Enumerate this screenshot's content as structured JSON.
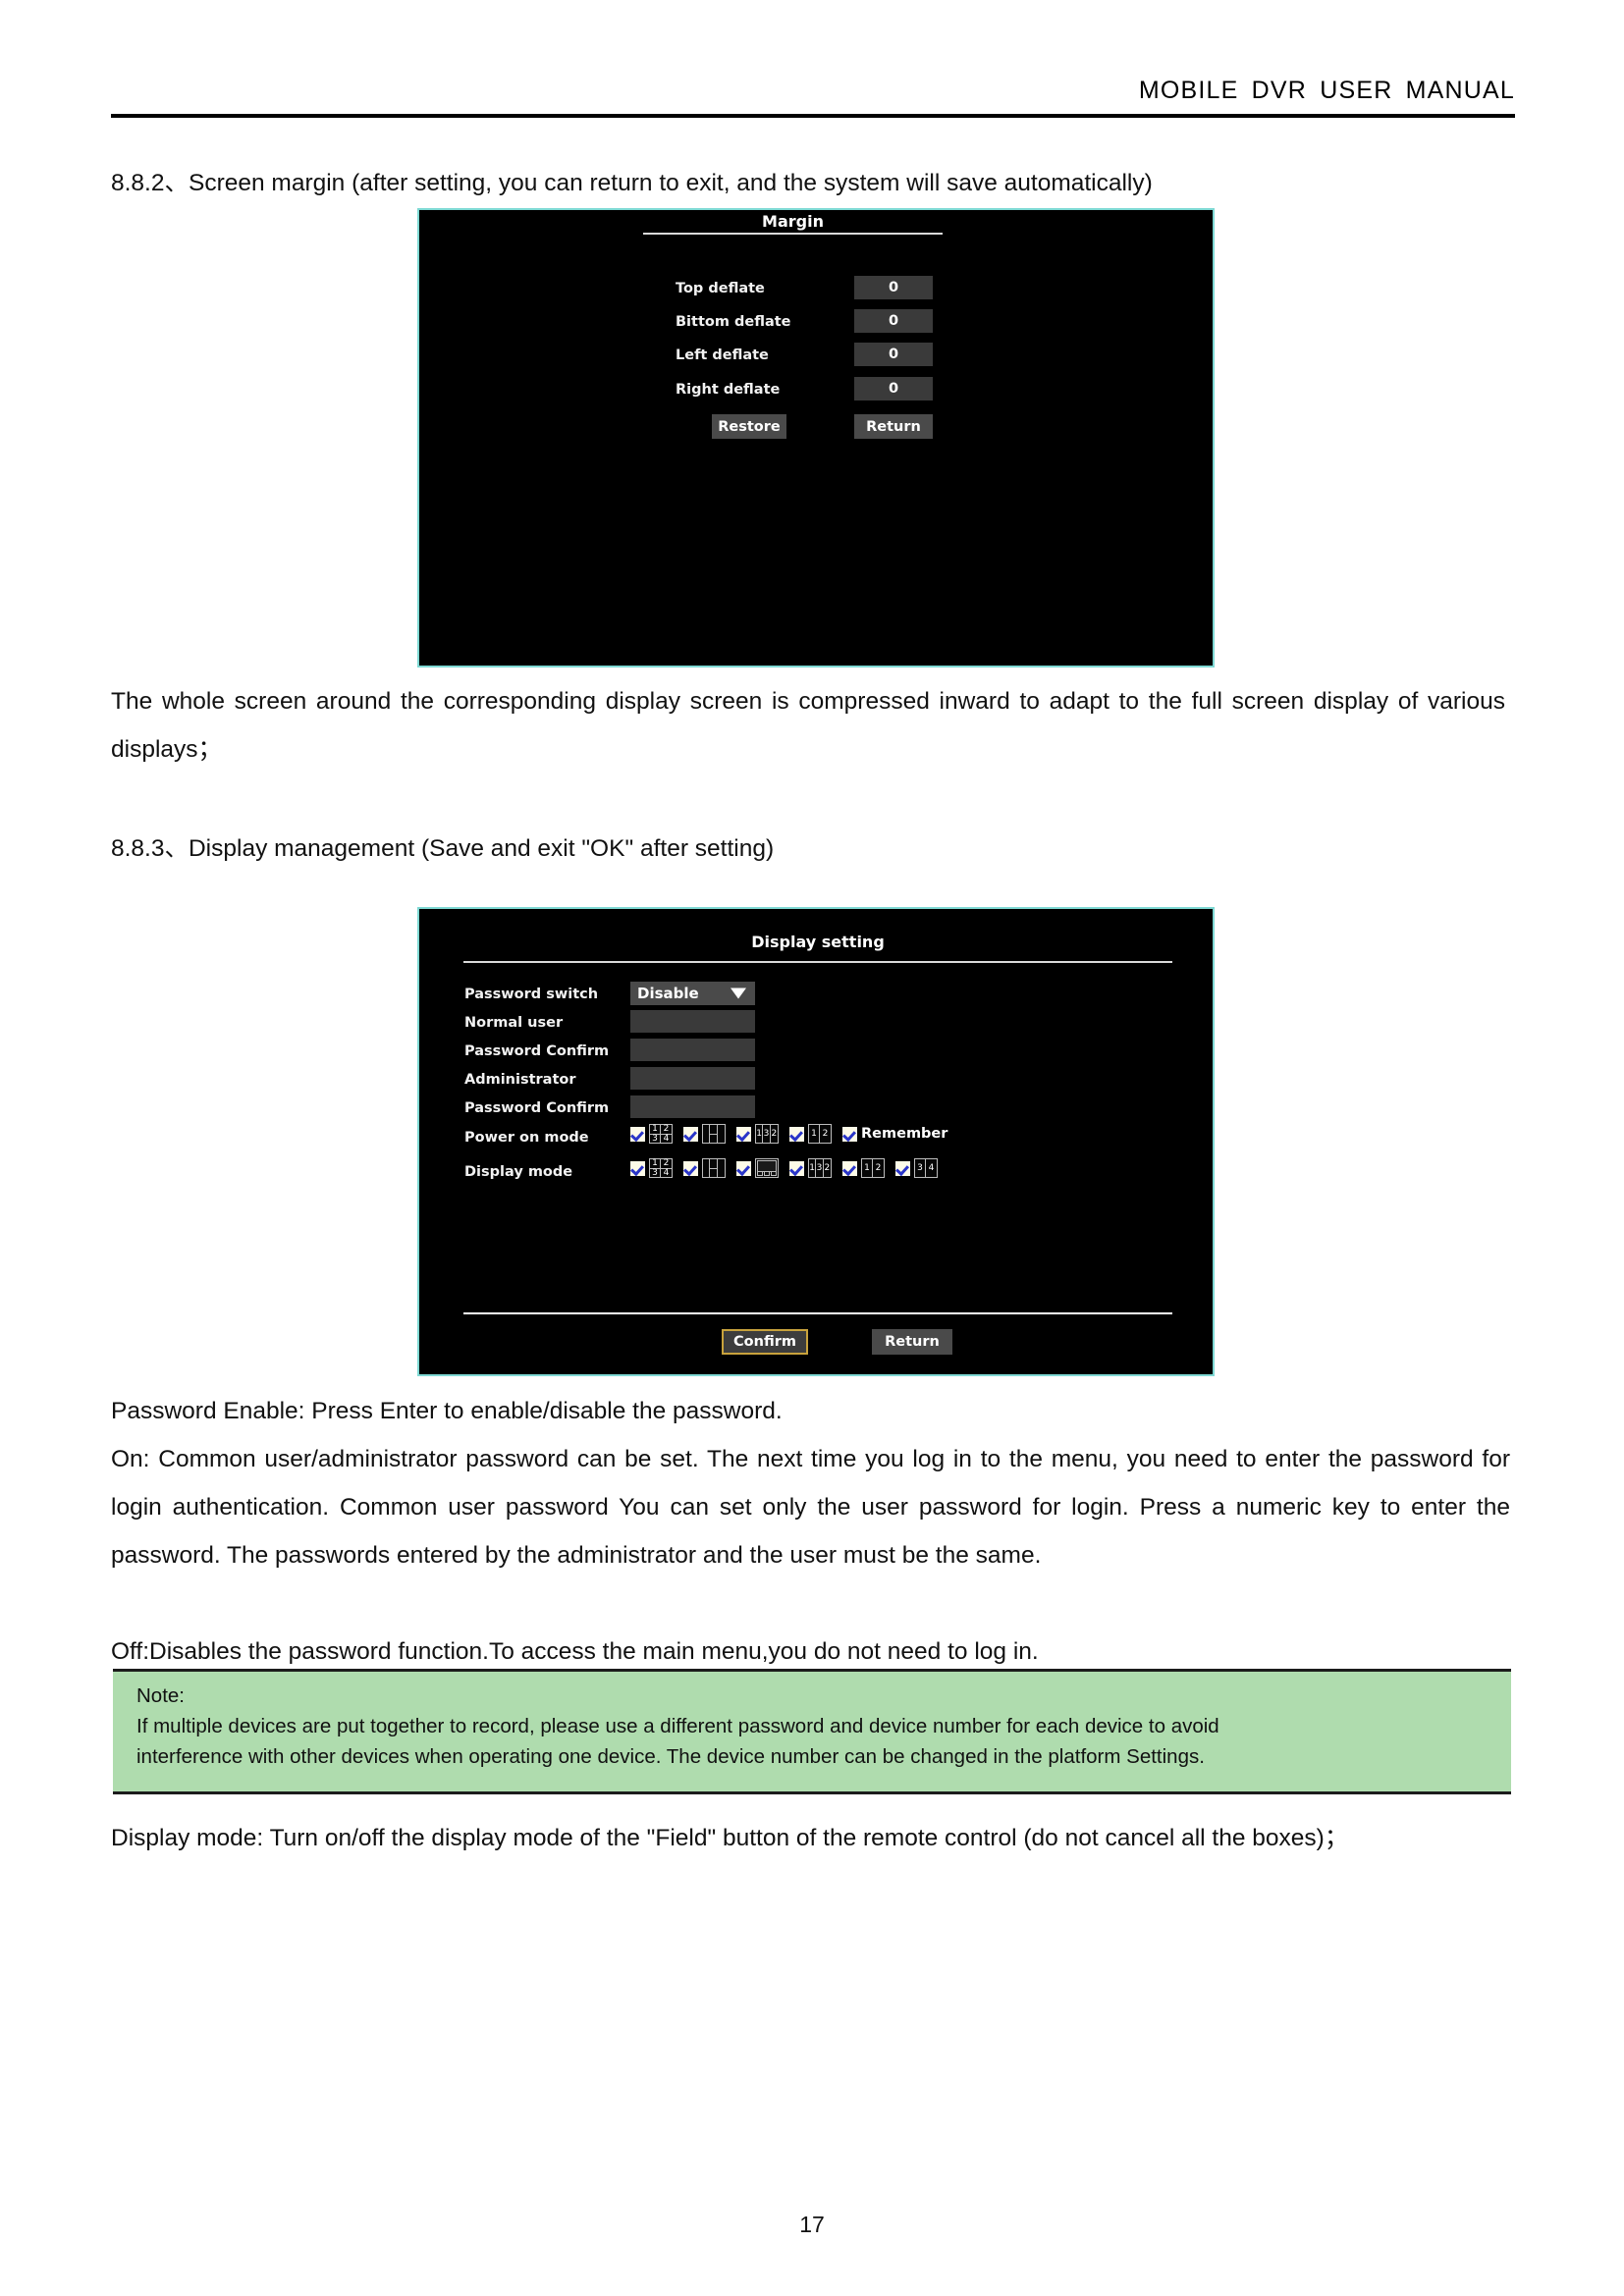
{
  "header": {
    "title": "MOBILE  DVR  USER  MANUAL"
  },
  "sections": {
    "s882_heading": "8.8.2、Screen margin (after setting, you can return to exit, and the system will save automatically)",
    "s882_para": "The whole screen around the corresponding display screen is compressed inward to adapt to the full screen display of various displays；",
    "s883_heading": "8.8.3、Display management (Save and exit \"OK\" after setting)"
  },
  "margin_dialog": {
    "title": "Margin",
    "rows": [
      {
        "label": "Top deflate",
        "value": "0"
      },
      {
        "label": "Bittom deflate",
        "value": "0"
      },
      {
        "label": "Left deflate",
        "value": "0"
      },
      {
        "label": "Right deflate",
        "value": "0"
      }
    ],
    "restore_label": "Restore",
    "return_label": "Return"
  },
  "display_dialog": {
    "title": "Display setting",
    "fields": [
      {
        "label": "Password switch",
        "type": "select",
        "value": "Disable"
      },
      {
        "label": "Normal user",
        "type": "input",
        "value": ""
      },
      {
        "label": "Password Confirm",
        "type": "input",
        "value": ""
      },
      {
        "label": "Administrator",
        "type": "input",
        "value": ""
      },
      {
        "label": "Password Confirm",
        "type": "input",
        "value": ""
      }
    ],
    "power_on_mode": {
      "label": "Power on mode",
      "options": [
        {
          "icon": "quad",
          "cells": [
            "1",
            "2",
            "3",
            "4"
          ],
          "checked": true
        },
        {
          "icon": "hsplit",
          "cells": [
            "",
            "",
            ""
          ],
          "checked": true
        },
        {
          "icon": "tri",
          "cells": [
            "1",
            "3",
            "2"
          ],
          "checked": true
        },
        {
          "icon": "duo",
          "cells": [
            "1",
            "2"
          ],
          "checked": true
        }
      ],
      "remember_label": "Remember",
      "remember_checked": true
    },
    "display_mode": {
      "label": "Display mode",
      "options": [
        {
          "icon": "quad",
          "cells": [
            "1",
            "2",
            "3",
            "4"
          ],
          "checked": true
        },
        {
          "icon": "hsplit",
          "cells": [
            "",
            "",
            ""
          ],
          "checked": true
        },
        {
          "icon": "pip",
          "cells": [],
          "checked": true
        },
        {
          "icon": "tri",
          "cells": [
            "1",
            "3",
            "2"
          ],
          "checked": true
        },
        {
          "icon": "duo",
          "cells": [
            "1",
            "2"
          ],
          "checked": true
        },
        {
          "icon": "duo",
          "cells": [
            "3",
            "4"
          ],
          "checked": true
        }
      ]
    },
    "confirm_label": "Confirm",
    "return_label": "Return"
  },
  "body": {
    "p1": "Password Enable: Press Enter to enable/disable the password.",
    "p2": "On: Common user/administrator password can be set.    The next time you log in to the menu, you need to enter the password for login authentication.    Common user password You can set only the user password for login. Press a numeric key to enter the password. The passwords entered by the administrator and the user must be the same.",
    "p3": "Off:Disables the password function.To access the main menu,you do not need to log in.",
    "p4": "Display mode: Turn on/off the display mode of the \"Field\" button of the remote control (do not cancel all the boxes)；"
  },
  "note": {
    "head": "Note:",
    "line1": "If multiple devices are put together to record, please use a different password and device number for each device to avoid",
    "line2": "interference with other devices when operating one device. The device number can be changed in the platform Settings."
  },
  "footer": {
    "page_number": "17"
  },
  "colors": {
    "note_bg": "#afdcae",
    "panel_border": "#7fd9d4",
    "focus_border": "#c8a23c",
    "check_blue": "#2a35c8"
  }
}
